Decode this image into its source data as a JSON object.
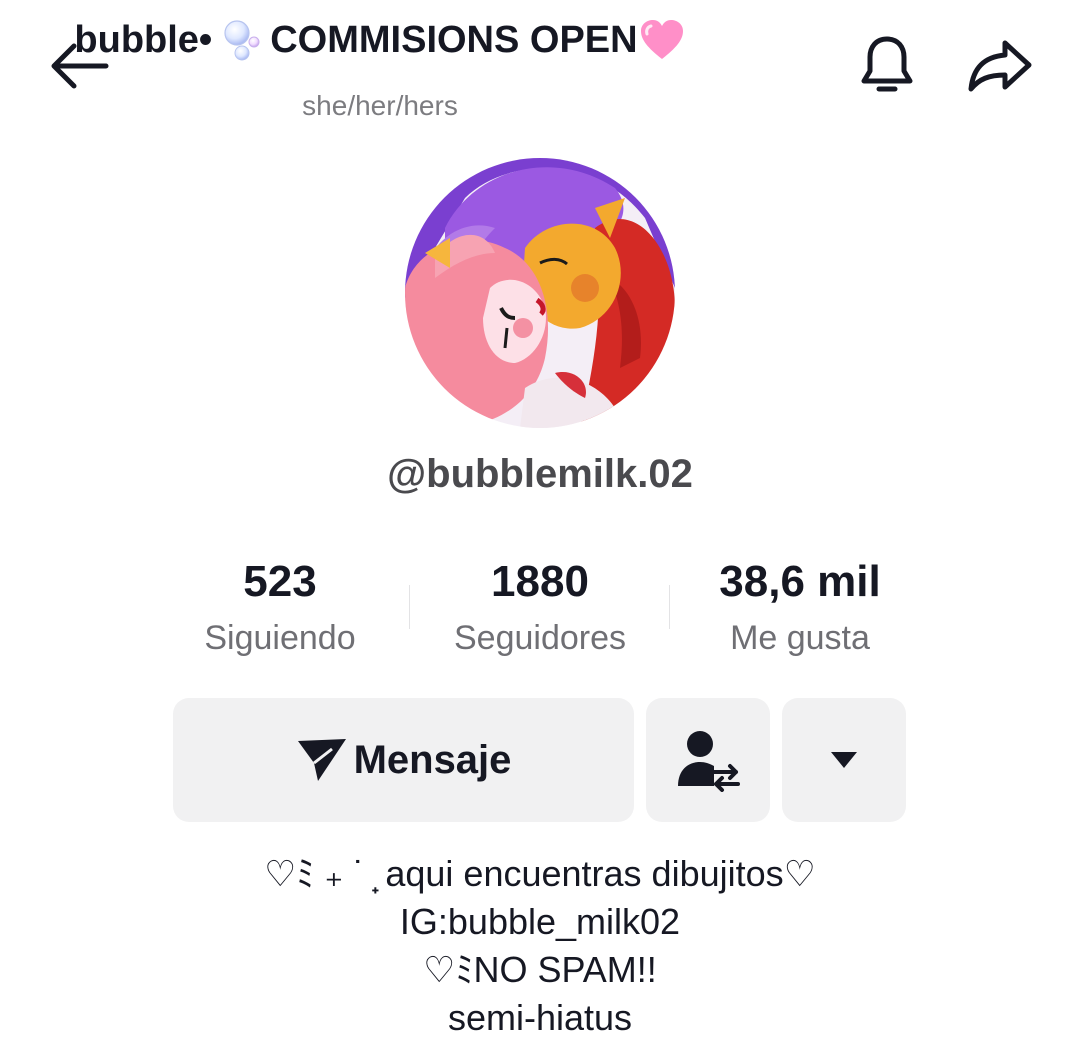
{
  "header": {
    "title_prefix": "bubble•",
    "title_main": "COMMISIONS OPEN",
    "pronouns": "she/her/hers",
    "back_icon": "back-arrow-icon",
    "bell_icon": "bell-icon",
    "share_icon": "share-arrow-icon"
  },
  "profile": {
    "handle": "@bubblemilk.02"
  },
  "stats": [
    {
      "value": "523",
      "label": "Siguiendo"
    },
    {
      "value": "1880",
      "label": "Seguidores"
    },
    {
      "value": "38,6 mil",
      "label": "Me gusta"
    }
  ],
  "actions": {
    "message_label": "Mensaje",
    "message_icon": "send-icon",
    "follow_icon": "user-swap-icon",
    "more_icon": "caret-down-icon"
  },
  "bio": {
    "lines": [
      "♡︎ﾐ ₊ ˙ ̟ aqui encuentras dibujitos♡︎",
      "IG:bubble_milk02",
      "♡︎ﾐNO SPAM!!",
      "semi-hiatus"
    ]
  },
  "colors": {
    "text_primary": "#161823",
    "text_secondary": "#6f6f74",
    "button_bg": "#f1f1f2"
  }
}
